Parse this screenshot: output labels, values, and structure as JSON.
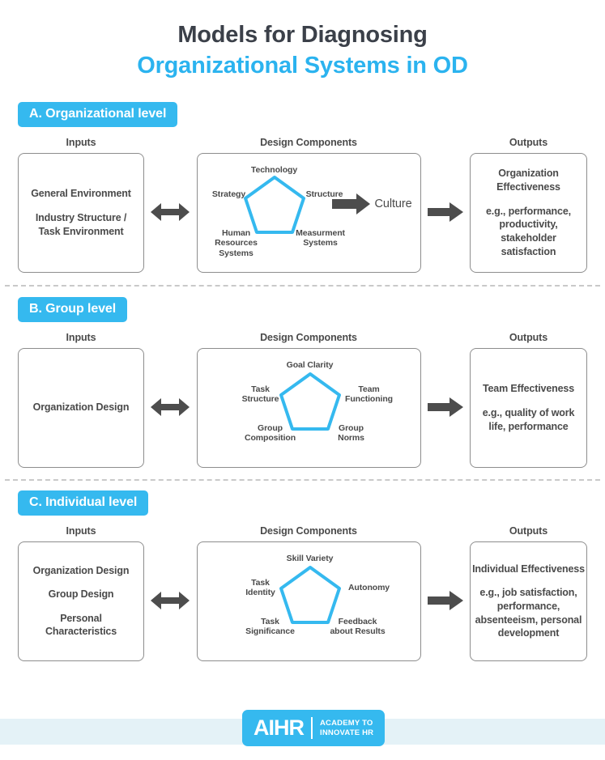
{
  "title": {
    "line1": "Models for Diagnosing",
    "line2": "Organizational Systems in OD"
  },
  "colors": {
    "accent": "#35b9ef",
    "title_dark": "#3b4049",
    "pentagon_stroke": "#35b9ef",
    "arrow": "#4d4d4d",
    "panel_border": "#8d8d8d",
    "footer_band": "#e4f2f7"
  },
  "column_headers": {
    "inputs": "Inputs",
    "design_components": "Design Components",
    "outputs": "Outputs"
  },
  "sections": [
    {
      "badge": "A. Organizational level",
      "inputs": [
        "General\nEnvironment",
        "Industry Structure /\nTask Environment"
      ],
      "pentagon_labels": {
        "top": "Technology",
        "left": "Strategy",
        "right": "Structure",
        "bottom_left": "Human\nResources\nSystems",
        "bottom_right": "Measurment\nSystems"
      },
      "extra_label": "Culture",
      "has_culture_arrow": true,
      "outputs_title": "Organization\nEffectiveness",
      "outputs_examples": "e.g., performance,\nproductivity,\nstakeholder\nsatisfaction"
    },
    {
      "badge": "B. Group level",
      "inputs": [
        "Organization\nDesign"
      ],
      "pentagon_labels": {
        "top": "Goal Clarity",
        "left": "Task\nStructure",
        "right": "Team\nFunctioning",
        "bottom_left": "Group\nComposition",
        "bottom_right": "Group\nNorms"
      },
      "extra_label": "",
      "has_culture_arrow": false,
      "outputs_title": "Team\nEffectiveness",
      "outputs_examples": "e.g., quality of\nwork life,\nperformance"
    },
    {
      "badge": "C. Individual level",
      "inputs": [
        "Organization\nDesign",
        "Group\nDesign",
        "Personal\nCharacteristics"
      ],
      "pentagon_labels": {
        "top": "Skill Variety",
        "left": "Task\nIdentity",
        "right": "Autonomy",
        "bottom_left": "Task\nSignificance",
        "bottom_right": "Feedback\nabout Results"
      },
      "extra_label": "",
      "has_culture_arrow": false,
      "outputs_title": "Individual\nEffectiveness",
      "outputs_examples": "e.g., job satisfaction,\nperformance,\nabsenteeism, personal\ndevelopment"
    }
  ],
  "footer": {
    "logo_main": "AIHR",
    "logo_sub": "ACADEMY TO\nINNOVATE HR"
  }
}
